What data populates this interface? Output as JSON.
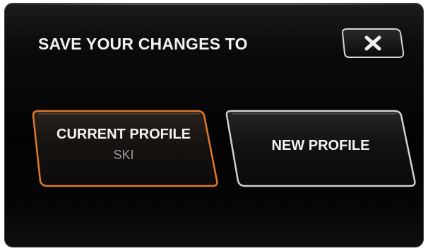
{
  "dialog": {
    "title": "SAVE YOUR CHANGES TO",
    "close_icon": "close-x-icon"
  },
  "options": {
    "current_profile": {
      "label": "CURRENT PROFILE",
      "profile_name": "SKI",
      "highlighted": true
    },
    "new_profile": {
      "label": "NEW PROFILE"
    }
  },
  "colors": {
    "background": "#030303",
    "text": "#f3f3f3",
    "subtext": "#9a9a9a",
    "highlight_border": "#e0782a",
    "button_border": "#cfcfcf"
  }
}
